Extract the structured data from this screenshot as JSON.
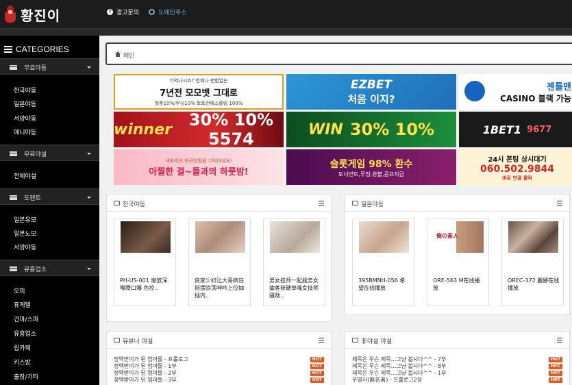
{
  "header": {
    "logo_text": "황진이",
    "links": [
      {
        "label": "광고문의",
        "icon": "question-icon"
      },
      {
        "label": "도메인주소",
        "icon": "gear-icon"
      }
    ]
  },
  "sidebar": {
    "title": "CATEGORIES",
    "sections": [
      {
        "label": "무료야동",
        "items": [
          "한국야동",
          "일본야동",
          "서양야동",
          "애니야동"
        ]
      },
      {
        "label": "무료야설",
        "items": [
          "전체야설"
        ]
      },
      {
        "label": "도렌트",
        "items": [
          "일본유모",
          "일본노모",
          "서양야동"
        ]
      },
      {
        "label": "유흥업소",
        "items": [
          "오피",
          "휴게텔",
          "건마/스파",
          "유흥업소",
          "립카페",
          "키스방",
          "출장/기타"
        ]
      }
    ]
  },
  "breadcrumb": {
    "label": "메인"
  },
  "banners": {
    "b1": {
      "line1": "기억나시죠? 언제나 변함없는",
      "line2": "7년전 모모벳 그대로",
      "line3": "첫충10%/무싱10% 토토전에스롤링 100%"
    },
    "b2": {
      "line1": "EZBET",
      "line2": "처음 이지?"
    },
    "b3": {
      "line1": "젠틀맨",
      "line2": "CASINO 블랙 가능"
    },
    "b4": {
      "line1": "winner",
      "line2": "30% 10% 5574"
    },
    "b5": {
      "line1": "WIN",
      "line2": "30% 10%"
    },
    "b6": {
      "line1": "1BET1",
      "line2": "9677"
    },
    "b7": {
      "line1": "색파의의 화끈한밤을 기억하세요!",
      "line2": "아찔한 걸~들과의 하룻밤!"
    },
    "b8": {
      "line1": "슬롯게임 98% 환수",
      "line2": "토너먼트,루징,환불,콤프지급"
    },
    "b9": {
      "line1": "24시 폰팅 상시대기",
      "line2": "060.502.9844",
      "line3": "바로 연결 클릭"
    }
  },
  "panels": {
    "korean": {
      "title": "한국야동",
      "cards": [
        {
          "text": "PH-US-001 燉放深喉瞪口爆 色控.."
        },
        {
          "text": "良家少妇让大哥疯狂挺摆浪荡呻吟上位抽插内.."
        },
        {
          "text": "男女技师一起服务女婾客筱硬草嘴女技师骚劫.."
        }
      ]
    },
    "japanese": {
      "title": "일본야동",
      "cards": [
        {
          "text": "395BMNH-056 希望在线播放"
        },
        {
          "text": "ORE-563 M在线播放",
          "thumb_label": "俺の素人"
        },
        {
          "text": "OREC-372 麗娜在线播放"
        }
      ]
    },
    "youtuber": {
      "title": "유뷰너 야설",
      "items": [
        "정액받이가 된 엄마들 - 프롤로그",
        "정액받이가 된 엄마들 - 1부",
        "정액받이가 된 엄마들 - 2부",
        "정액받이가 된 엄마들 - 3부"
      ],
      "badge": "HOT"
    },
    "nonyasul": {
      "title": "非야설 야설",
      "items": [
        "제목은 무슨 제목...그냥 봅시다^^ - 7부",
        "제목은 무슨 제목...그냥 봅시다^^ - 8부",
        "제목은 무슨 제목...그냥 봅시다^^ - 1부",
        "무명자(無名者) - 프롤로그2장"
      ],
      "badge": "HOT"
    }
  }
}
